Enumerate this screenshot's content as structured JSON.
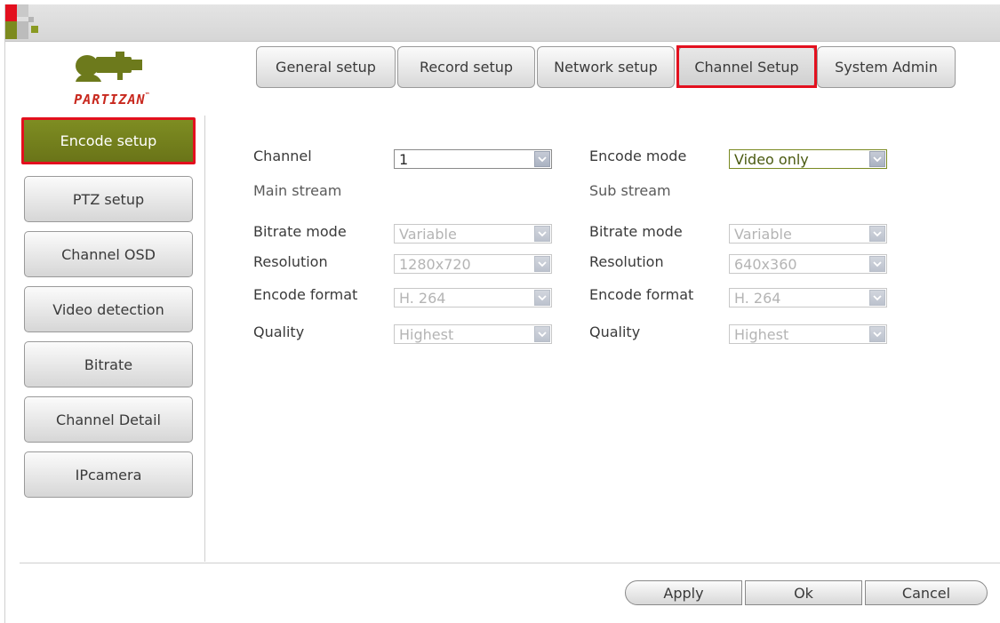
{
  "brand": {
    "name": "PARTIZAN",
    "tm": "™",
    "colors": {
      "red": "#e3101e",
      "green_active": "#75831e",
      "logo_olive": "#6d7a1c"
    }
  },
  "tabs": [
    {
      "label": "General setup"
    },
    {
      "label": "Record setup"
    },
    {
      "label": "Network setup"
    },
    {
      "label": "Channel Setup"
    },
    {
      "label": "System Admin"
    }
  ],
  "active_tab": "Channel Setup",
  "sidebar": {
    "items": [
      {
        "label": "Encode setup"
      },
      {
        "label": "PTZ setup"
      },
      {
        "label": "Channel OSD"
      },
      {
        "label": "Video detection"
      },
      {
        "label": "Bitrate"
      },
      {
        "label": "Channel Detail"
      },
      {
        "label": "IPcamera"
      }
    ],
    "active": "Encode setup"
  },
  "form": {
    "channel": {
      "label": "Channel",
      "value": "1"
    },
    "encode_mode": {
      "label": "Encode mode",
      "value": "Video only"
    },
    "main": {
      "heading": "Main stream",
      "bitrate_mode": {
        "label": "Bitrate mode",
        "value": "Variable"
      },
      "resolution": {
        "label": "Resolution",
        "value": "1280x720"
      },
      "encode_format": {
        "label": "Encode format",
        "value": "H. 264"
      },
      "quality": {
        "label": "Quality",
        "value": "Highest"
      }
    },
    "sub": {
      "heading": "Sub stream",
      "bitrate_mode": {
        "label": "Bitrate mode",
        "value": "Variable"
      },
      "resolution": {
        "label": "Resolution",
        "value": "640x360"
      },
      "encode_format": {
        "label": "Encode format",
        "value": "H. 264"
      },
      "quality": {
        "label": "Quality",
        "value": "Highest"
      }
    }
  },
  "footer": {
    "apply": "Apply",
    "ok": "Ok",
    "cancel": "Cancel"
  }
}
